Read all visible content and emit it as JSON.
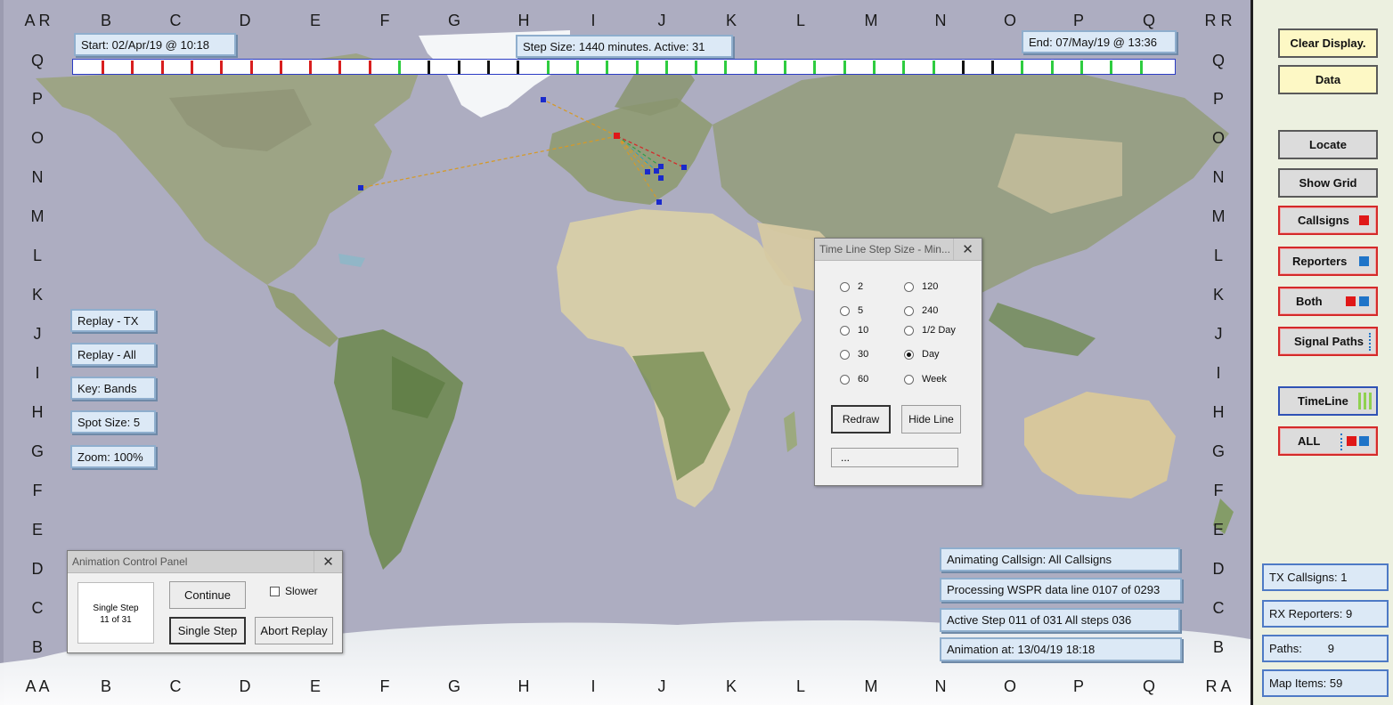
{
  "grid": {
    "top_row": [
      "A R",
      "B",
      "C",
      "D",
      "E",
      "F",
      "G",
      "H",
      "I",
      "J",
      "K",
      "L",
      "M",
      "N",
      "O",
      "P",
      "Q",
      "R R"
    ],
    "bottom_row": [
      "A A",
      "B",
      "C",
      "D",
      "E",
      "F",
      "G",
      "H",
      "I",
      "J",
      "K",
      "L",
      "M",
      "N",
      "O",
      "P",
      "Q",
      "R A"
    ],
    "left_col": [
      "Q",
      "P",
      "O",
      "N",
      "M",
      "L",
      "K",
      "J",
      "I",
      "H",
      "G",
      "F",
      "E",
      "D",
      "C",
      "B"
    ],
    "right_col": [
      "Q",
      "P",
      "O",
      "N",
      "M",
      "L",
      "K",
      "J",
      "I",
      "H",
      "G",
      "F",
      "E",
      "D",
      "C",
      "B"
    ]
  },
  "header": {
    "start": "Start: 02/Apr/19 @ 10:18",
    "step": "Step Size: 1440 minutes. Active: 31",
    "end": "End:  07/May/19 @ 13:36"
  },
  "timeline": {
    "ticks": [
      "red",
      "red",
      "red",
      "red",
      "red",
      "red",
      "red",
      "red",
      "red",
      "red",
      "green",
      "black",
      "black",
      "black",
      "black",
      "green",
      "green",
      "green",
      "green",
      "green",
      "green",
      "green",
      "green",
      "green",
      "green",
      "green",
      "green",
      "green",
      "green",
      "black",
      "black",
      "green",
      "green",
      "green",
      "green",
      "green",
      "white"
    ],
    "colors": {
      "red": "#d81e1e",
      "green": "#2ecc40",
      "black": "#111111",
      "white": "#ffffff"
    }
  },
  "left_buttons": [
    "Replay - TX",
    "Replay - All",
    "Key:  Bands",
    "Spot Size:   5",
    "Zoom: 100%"
  ],
  "step_dialog": {
    "title": "Time Line Step Size - Min...",
    "close": "✕",
    "options_left": [
      "2",
      "5",
      "10",
      "30",
      "60"
    ],
    "options_right": [
      "120",
      "240",
      "1/2 Day",
      "Day",
      "Week"
    ],
    "selected": "Day",
    "redraw": "Redraw",
    "hide_line": "Hide Line",
    "status": "..."
  },
  "anim_panel": {
    "title": "Animation Control Panel",
    "close": "✕",
    "display_line1": "Single Step",
    "display_line2": "11 of 31",
    "continue": "Continue",
    "slower": "Slower",
    "single_step": "Single Step",
    "abort": "Abort Replay"
  },
  "info": {
    "callsign": "Animating Callsign:      All Callsigns",
    "processing": "Processing WSPR data line 0107 of  0293",
    "active_step": "Active Step 011 of 031    All steps 036",
    "animation_at": "Animation at: 13/04/19  18:18"
  },
  "sidebar": {
    "clear": "Clear Display.",
    "data": "Data",
    "locate": "Locate",
    "show_grid": "Show Grid",
    "callsigns": "Callsigns",
    "reporters": "Reporters",
    "both": "Both",
    "signal_paths": "Signal Paths",
    "timeline": "TimeLine",
    "all": "ALL"
  },
  "stats": {
    "tx": "TX Callsigns: 1",
    "rx": "RX Reporters: 9",
    "paths": "Paths:        9",
    "items": "Map Items: 59"
  },
  "colors": {
    "callsign_marker": "#e01818",
    "reporter_marker": "#1f74c8",
    "timeline_green": "#8fd14f"
  }
}
